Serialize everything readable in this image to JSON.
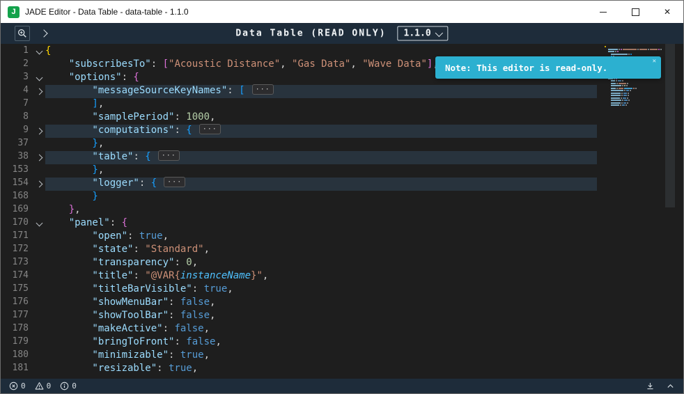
{
  "window": {
    "title": "JADE Editor - Data Table - data-table - 1.1.0"
  },
  "toolbar": {
    "title": "Data Table (READ ONLY)",
    "version": "1.1.0"
  },
  "notification": {
    "text": "Note: This editor is read-only."
  },
  "status_bar": {
    "errors": "0",
    "warnings": "0",
    "infos": "0"
  },
  "icons": {
    "app_logo_letter": "J",
    "minimize": "—",
    "maximize": "▢",
    "close": "✕",
    "toast_close": "✕",
    "fold_ellipsis": "···",
    "zoom": "magnifier-plus",
    "expand": "chevron-right",
    "version_chevron": "chevron-down",
    "errors": "circle-x",
    "warnings": "triangle-exclamation",
    "infos": "circle-i",
    "download": "arrow-down-to-line",
    "collapse": "chevron-up"
  },
  "colors": {
    "toast": "#2cb0d0",
    "toolbar_bg": "#1e2c3a",
    "editor_bg": "#1e1e1e",
    "logo": "#13a24b",
    "key": "#9cdcfe",
    "string": "#ce9178",
    "number": "#b5cea8",
    "boolean": "#569cd6"
  },
  "editor": {
    "lines": [
      {
        "num": "1",
        "ind": 0,
        "fold": "down",
        "folded": false,
        "tokens": [
          [
            "{",
            "g0"
          ]
        ]
      },
      {
        "num": "2",
        "ind": 1,
        "fold": "",
        "folded": false,
        "tokens": [
          [
            "\"subscribesTo\"",
            "k"
          ],
          [
            ": ",
            "p"
          ],
          [
            "[",
            "g1"
          ],
          [
            "\"Acoustic Distance\"",
            "s"
          ],
          [
            ", ",
            "p"
          ],
          [
            "\"Gas Data\"",
            "s"
          ],
          [
            ", ",
            "p"
          ],
          [
            "\"Wave Data\"",
            "s"
          ],
          [
            "]",
            "g1"
          ],
          [
            ",",
            "p"
          ]
        ]
      },
      {
        "num": "3",
        "ind": 1,
        "fold": "down",
        "folded": false,
        "tokens": [
          [
            "\"options\"",
            "k"
          ],
          [
            ": ",
            "p"
          ],
          [
            "{",
            "g1"
          ]
        ]
      },
      {
        "num": "4",
        "ind": 2,
        "fold": "right",
        "folded": true,
        "tokens": [
          [
            "\"messageSourceKeyNames\"",
            "k"
          ],
          [
            ": ",
            "p"
          ],
          [
            "[",
            "g2"
          ]
        ]
      },
      {
        "num": "7",
        "ind": 2,
        "fold": "",
        "folded": false,
        "tokens": [
          [
            "]",
            "g2"
          ],
          [
            ",",
            "p"
          ]
        ]
      },
      {
        "num": "8",
        "ind": 2,
        "fold": "",
        "folded": false,
        "tokens": [
          [
            "\"samplePeriod\"",
            "k"
          ],
          [
            ": ",
            "p"
          ],
          [
            "1000",
            "n"
          ],
          [
            ",",
            "p"
          ]
        ]
      },
      {
        "num": "9",
        "ind": 2,
        "fold": "right",
        "folded": true,
        "tokens": [
          [
            "\"computations\"",
            "k"
          ],
          [
            ": ",
            "p"
          ],
          [
            "{",
            "g2"
          ]
        ]
      },
      {
        "num": "37",
        "ind": 2,
        "fold": "",
        "folded": false,
        "tokens": [
          [
            "}",
            "g2"
          ],
          [
            ",",
            "p"
          ]
        ]
      },
      {
        "num": "38",
        "ind": 2,
        "fold": "right",
        "folded": true,
        "tokens": [
          [
            "\"table\"",
            "k"
          ],
          [
            ": ",
            "p"
          ],
          [
            "{",
            "g2"
          ]
        ]
      },
      {
        "num": "153",
        "ind": 2,
        "fold": "",
        "folded": false,
        "tokens": [
          [
            "}",
            "g2"
          ],
          [
            ",",
            "p"
          ]
        ]
      },
      {
        "num": "154",
        "ind": 2,
        "fold": "right",
        "folded": true,
        "tokens": [
          [
            "\"logger\"",
            "k"
          ],
          [
            ": ",
            "p"
          ],
          [
            "{",
            "g2"
          ]
        ]
      },
      {
        "num": "168",
        "ind": 2,
        "fold": "",
        "folded": false,
        "tokens": [
          [
            "}",
            "g2"
          ]
        ]
      },
      {
        "num": "169",
        "ind": 1,
        "fold": "",
        "folded": false,
        "tokens": [
          [
            "}",
            "g1"
          ],
          [
            ",",
            "p"
          ]
        ]
      },
      {
        "num": "170",
        "ind": 1,
        "fold": "down",
        "folded": false,
        "tokens": [
          [
            "\"panel\"",
            "k"
          ],
          [
            ": ",
            "p"
          ],
          [
            "{",
            "g1"
          ]
        ]
      },
      {
        "num": "171",
        "ind": 2,
        "fold": "",
        "folded": false,
        "tokens": [
          [
            "\"open\"",
            "k"
          ],
          [
            ": ",
            "p"
          ],
          [
            "true",
            "b"
          ],
          [
            ",",
            "p"
          ]
        ]
      },
      {
        "num": "172",
        "ind": 2,
        "fold": "",
        "folded": false,
        "tokens": [
          [
            "\"state\"",
            "k"
          ],
          [
            ": ",
            "p"
          ],
          [
            "\"Standard\"",
            "s"
          ],
          [
            ",",
            "p"
          ]
        ]
      },
      {
        "num": "173",
        "ind": 2,
        "fold": "",
        "folded": false,
        "tokens": [
          [
            "\"transparency\"",
            "k"
          ],
          [
            ": ",
            "p"
          ],
          [
            "0",
            "n"
          ],
          [
            ",",
            "p"
          ]
        ]
      },
      {
        "num": "174",
        "ind": 2,
        "fold": "",
        "folded": false,
        "tokens": [
          [
            "\"title\"",
            "k"
          ],
          [
            ": ",
            "p"
          ],
          [
            "\"@VAR{",
            "s"
          ],
          [
            "instanceName",
            "v"
          ],
          [
            "}\"",
            "s"
          ],
          [
            ",",
            "p"
          ]
        ]
      },
      {
        "num": "175",
        "ind": 2,
        "fold": "",
        "folded": false,
        "tokens": [
          [
            "\"titleBarVisible\"",
            "k"
          ],
          [
            ": ",
            "p"
          ],
          [
            "true",
            "b"
          ],
          [
            ",",
            "p"
          ]
        ]
      },
      {
        "num": "176",
        "ind": 2,
        "fold": "",
        "folded": false,
        "tokens": [
          [
            "\"showMenuBar\"",
            "k"
          ],
          [
            ": ",
            "p"
          ],
          [
            "false",
            "b"
          ],
          [
            ",",
            "p"
          ]
        ]
      },
      {
        "num": "177",
        "ind": 2,
        "fold": "",
        "folded": false,
        "tokens": [
          [
            "\"showToolBar\"",
            "k"
          ],
          [
            ": ",
            "p"
          ],
          [
            "false",
            "b"
          ],
          [
            ",",
            "p"
          ]
        ]
      },
      {
        "num": "178",
        "ind": 2,
        "fold": "",
        "folded": false,
        "tokens": [
          [
            "\"makeActive\"",
            "k"
          ],
          [
            ": ",
            "p"
          ],
          [
            "false",
            "b"
          ],
          [
            ",",
            "p"
          ]
        ]
      },
      {
        "num": "179",
        "ind": 2,
        "fold": "",
        "folded": false,
        "tokens": [
          [
            "\"bringToFront\"",
            "k"
          ],
          [
            ": ",
            "p"
          ],
          [
            "false",
            "b"
          ],
          [
            ",",
            "p"
          ]
        ]
      },
      {
        "num": "180",
        "ind": 2,
        "fold": "",
        "folded": false,
        "tokens": [
          [
            "\"minimizable\"",
            "k"
          ],
          [
            ": ",
            "p"
          ],
          [
            "true",
            "b"
          ],
          [
            ",",
            "p"
          ]
        ]
      },
      {
        "num": "181",
        "ind": 2,
        "fold": "",
        "folded": false,
        "tokens": [
          [
            "\"resizable\"",
            "k"
          ],
          [
            ": ",
            "p"
          ],
          [
            "true",
            "b"
          ],
          [
            ",",
            "p"
          ]
        ]
      }
    ]
  }
}
